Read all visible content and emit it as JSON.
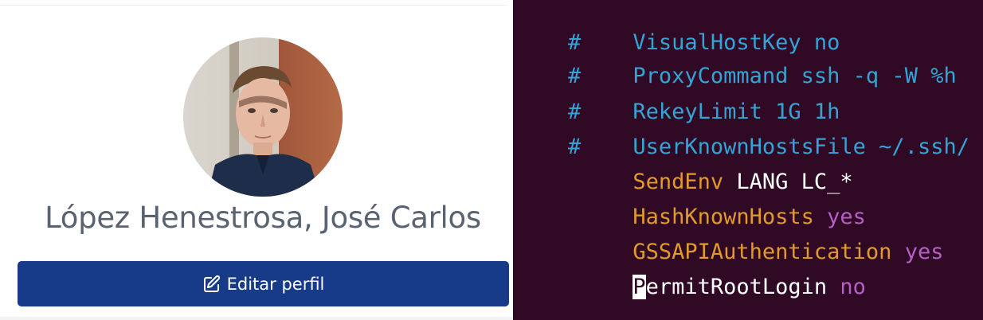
{
  "profile": {
    "name": "López Henestrosa, José Carlos",
    "edit_button_label": "Editar perfil",
    "avatar_alt": "profile photo"
  },
  "terminal": {
    "lines": [
      {
        "prefix": "#",
        "text": "VisualHostKey no"
      },
      {
        "prefix": "#",
        "text": "ProxyCommand ssh -q -W %h"
      },
      {
        "prefix": "#",
        "text": "RekeyLimit 1G 1h"
      },
      {
        "prefix": "#",
        "text": "UserKnownHostsFile ~/.ssh/"
      },
      {
        "key": "SendEnv",
        "value": "LANG LC_*"
      },
      {
        "key": "HashKnownHosts",
        "value": "yes"
      },
      {
        "key": "GSSAPIAuthentication",
        "value": "yes"
      },
      {
        "key_cursor": "P",
        "key": "ermitRootLogin",
        "value": "no"
      }
    ],
    "tilde": "~"
  },
  "colors": {
    "terminal_bg": "#300a24",
    "comment": "#34a4d8",
    "keyword": "#e39a2a",
    "boolean": "#b75ec8",
    "button_bg": "#173b89",
    "name_text": "#586271"
  }
}
